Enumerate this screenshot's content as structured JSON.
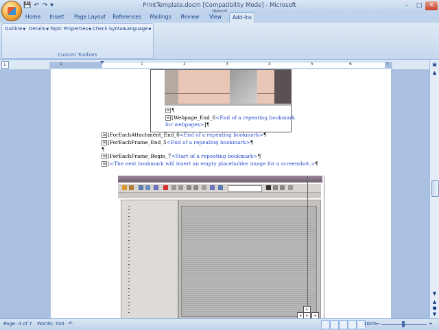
{
  "window": {
    "title": "PrintTemplate.docm [Compatibility Mode] - Microsoft Word",
    "minimize": "–",
    "maximize": "□",
    "close": "✕"
  },
  "qat": {
    "save": "💾",
    "undo": "↶",
    "redo": "↷",
    "more": "▾"
  },
  "tabs": [
    "Home",
    "Insert",
    "Page Layout",
    "References",
    "Mailings",
    "Review",
    "View",
    "Add-Ins"
  ],
  "active_tab": "Add-Ins",
  "ribbon": {
    "items": [
      "Outline",
      "Details",
      "Topic Properties",
      "Check Syntax",
      "Language"
    ],
    "group_label": "Custom Toolbars"
  },
  "ruler": {
    "numbers": [
      "1",
      "1",
      "2",
      "3",
      "4",
      "5",
      "6",
      "7"
    ]
  },
  "document": {
    "line1_code": "[Webpage_End_6",
    "line1_note": "<End of a repeating bookmark",
    "line1b_note": "for webpages>",
    "line1b_end": "]¶",
    "line2_code": "[ForEachAttachment_End_6",
    "line2_note": "<End of a repeating bookmark>",
    "line2_end": "¶",
    "line3_code": "[ForEachFrame_End_5",
    "line3_note": "<End of a repeating bookmark>",
    "line3_end": "¶",
    "line4": "¶",
    "line5_code": "[ForEachFrame_Begin_7",
    "line5_note": "<Start of a repeating bookmark>",
    "line5_end": "¶",
    "line6_note": "<The next bookmark will insert an empty placeholder image for a screenshot.>",
    "line6_end": "¶",
    "anchor_pilcrow": "¶"
  },
  "status": {
    "page": "Page: 4 of 7",
    "words": "Words: 740",
    "zoom": "100%",
    "zoom_minus": "−",
    "zoom_plus": "+"
  },
  "scroll": {
    "up": "▲",
    "down": "▼",
    "prev": "▲",
    "select": "●",
    "next": "▼"
  }
}
